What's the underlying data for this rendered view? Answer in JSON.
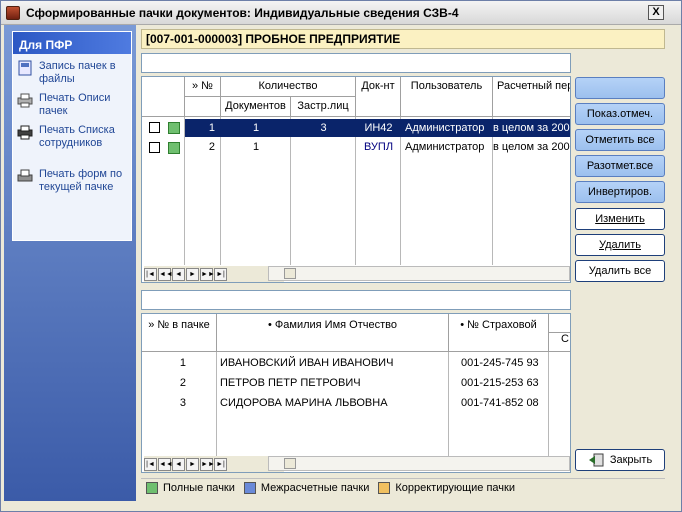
{
  "window": {
    "title": "Сформированные пачки документов: Индивидуальные сведения СЗВ-4",
    "close_label": "X"
  },
  "side": {
    "header": "Для ПФР",
    "tasks": [
      {
        "label": "Запись пачек в файлы",
        "icon": "save-files-icon"
      },
      {
        "label": "Печать Описи пачек",
        "icon": "printer-icon"
      },
      {
        "label": "Печать Списка сотрудников",
        "icon": "printer-icon"
      },
      {
        "label": "Печать форм по текущей пачке",
        "icon": "print-forms-icon"
      }
    ]
  },
  "org": "[007-001-000003] ПРОБНОЕ ПРЕДПРИЯТИЕ",
  "top_grid": {
    "headers": {
      "num": "» №",
      "qty": "Количество",
      "docs": "Документов",
      "insured": "Застр.лиц",
      "doc": "Док-нт",
      "user": "Пользователь",
      "period": "Расчетный пер"
    },
    "rows": [
      {
        "num": "1",
        "docs": "1",
        "insured": "3",
        "doc": "ИН42",
        "user": "Администратор",
        "period": "в целом за 200"
      },
      {
        "num": "2",
        "docs": "1",
        "insured": "",
        "doc": "ВУПЛ",
        "user": "Администратор",
        "period": "в целом за 200"
      }
    ]
  },
  "bottom_grid": {
    "headers": {
      "num": "» № в пачке",
      "fio": "• Фамилия Имя Отчество",
      "snils": "• № Страховой",
      "extra": "С"
    },
    "rows": [
      {
        "num": "1",
        "fio": "ИВАНОВСКИЙ ИВАН ИВАНОВИЧ",
        "snils": "001-245-745 93"
      },
      {
        "num": "2",
        "fio": "ПЕТРОВ ПЕТР ПЕТРОВИЧ",
        "snils": "001-215-253 63"
      },
      {
        "num": "3",
        "fio": "СИДОРОВА МАРИНА ЛЬВОВНА",
        "snils": "001-741-852 08"
      }
    ]
  },
  "buttons": {
    "blank": "",
    "show_marked": "Показ.отмеч.",
    "mark_all": "Отметить все",
    "unmark_all": "Разотмет.все",
    "invert": "Инвертиров.",
    "edit": "Изменить",
    "delete": "Удалить",
    "delete_all": "Удалить все",
    "close": "Закрыть"
  },
  "nav": [
    "|◄",
    "◄◄",
    "◄",
    "►",
    "►►",
    "►|"
  ],
  "legend": [
    {
      "label": "Полные пачки",
      "color": "#6fbf6f"
    },
    {
      "label": "Межрасчетные пачки",
      "color": "#6a8ad8"
    },
    {
      "label": "Корректирующие пачки",
      "color": "#f0c060"
    }
  ],
  "colors": {
    "selection": "#0a246a",
    "header_gradient": "#2c58c4",
    "doc_text": "#000080"
  }
}
